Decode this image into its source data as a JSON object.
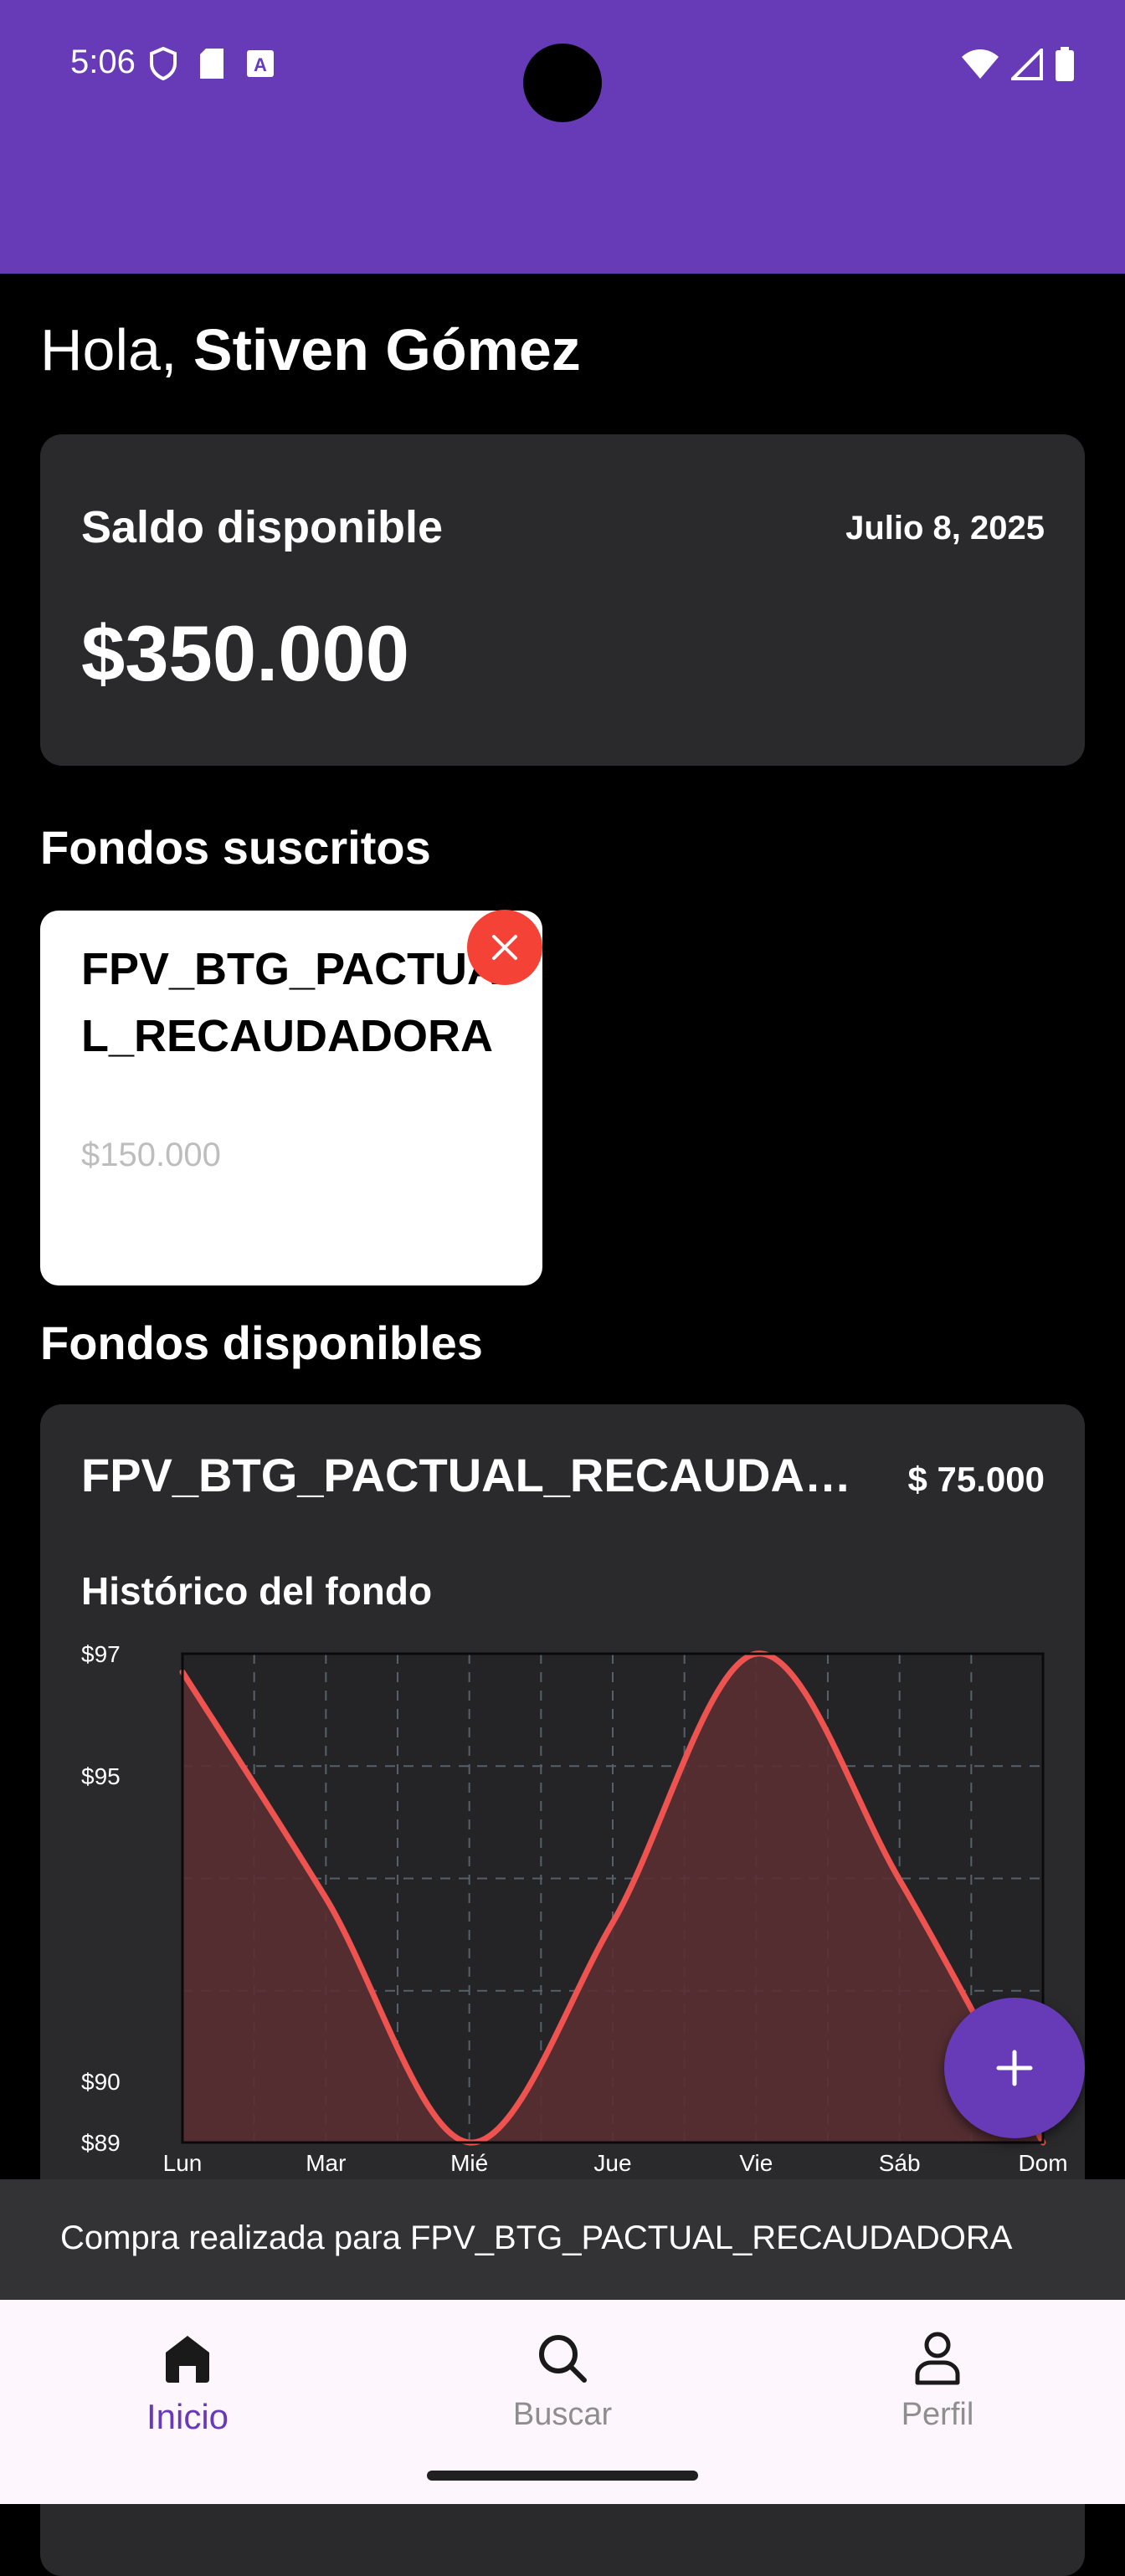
{
  "status_bar": {
    "time": "5:06",
    "color": "#673ab7"
  },
  "greeting": {
    "prefix": "Hola, ",
    "name": "Stiven Gómez"
  },
  "balance": {
    "label": "Saldo disponible",
    "date": "Julio 8, 2025",
    "amount": "$350.000"
  },
  "subscribed": {
    "title": "Fondos suscritos",
    "items": [
      {
        "name": "FPV_BTG_PACTUAL_RECAUDADORA",
        "amount": "$150.000"
      }
    ]
  },
  "available": {
    "title": "Fondos disponibles",
    "items": [
      {
        "name": "FPV_BTG_PACTUAL_RECAUDADORA",
        "price": "$ 75.000",
        "chart_title": "Histórico del fondo"
      }
    ]
  },
  "chart_data": {
    "type": "area",
    "title": "Histórico del fondo",
    "categories": [
      "Lun",
      "Mar",
      "Mié",
      "Jue",
      "Vie",
      "Sáb",
      "Dom"
    ],
    "series": [
      {
        "values": [
          96.7,
          93.0,
          89.0,
          92.6,
          97.0,
          93.3,
          89.0
        ]
      }
    ],
    "y_ticks": [
      {
        "value": 97,
        "label": "$97"
      },
      {
        "value": 95,
        "label": "$95"
      },
      {
        "value": 90,
        "label": "$90"
      },
      {
        "value": 89,
        "label": "$89"
      }
    ],
    "ylim": [
      89,
      97
    ],
    "grid": true,
    "line_color": "#ef5350",
    "fill_color": "#5a2f33"
  },
  "snackbar": {
    "message": "Compra realizada para FPV_BTG_PACTUAL_RECAUDADORA"
  },
  "nav": {
    "items": [
      {
        "label": "Inicio",
        "icon": "home-icon",
        "active": true
      },
      {
        "label": "Buscar",
        "icon": "search-icon",
        "active": false
      },
      {
        "label": "Perfil",
        "icon": "person-icon",
        "active": false
      }
    ],
    "active_color": "#673ab7"
  }
}
